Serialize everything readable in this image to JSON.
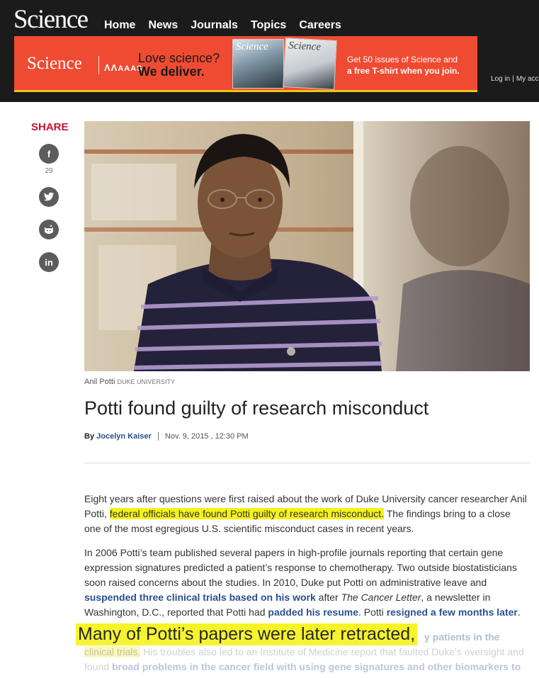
{
  "header": {
    "logo": "Science",
    "nav": [
      "Home",
      "News",
      "Journals",
      "Topics",
      "Careers"
    ],
    "login": "Log in",
    "my_account": "My acc"
  },
  "ad": {
    "brand": "Science",
    "aaas": "AAAS",
    "slogan_line1": "Love science?",
    "slogan_line2": "We deliver.",
    "magazine1_title": "Science",
    "magazine2_title": "Science",
    "offer_line1": "Get 50 issues of Science and",
    "offer_line2": "a free T-shirt when you join."
  },
  "share": {
    "label": "SHARE",
    "facebook_count": "29",
    "icons": [
      "facebook-icon",
      "twitter-icon",
      "reddit-icon",
      "linkedin-icon"
    ]
  },
  "article": {
    "caption_name": "Anil Potti",
    "caption_credit": "DUKE UNIVERSITY",
    "headline": "Potti found guilty of research misconduct",
    "by": "By",
    "author": "Jocelyn Kaiser",
    "date": "Nov. 9, 2015 , 12:30 PM",
    "p1": {
      "a": "Eight years after questions were first raised about the work of Duke University cancer researcher Anil Potti, ",
      "highlight": "federal officials have found Potti guilty of research misconduct.",
      "b": " The findings bring to a close one of the most egregious U.S. scientific misconduct cases in recent years."
    },
    "p2": {
      "a": "In 2006 Potti’s team published several papers in high-profile journals reporting that certain gene expression signatures predicted a patient’s response to chemotherapy. Two outside biostatisticians soon raised concerns about the studies. In 2010, Duke put Potti on administrative leave and ",
      "link1": "suspended three clinical trials based on his work",
      "b": " after ",
      "italic": "The Cancer Letter",
      "c": ", a newsletter in Washington, D.C., reported that Potti had ",
      "link2": "padded his resume",
      "d": ". Potti ",
      "link3": "resigned a few months later",
      "e": "."
    },
    "callout": "Many of Potti’s papers were later retracted,",
    "p3": {
      "ghost_link": "y patients in the",
      "hl": "clinical trials.",
      "a": " His troubles also led to an Institute of Medicine report that faulted Duke’s oversight and found ",
      "link": "broad problems in the cancer field with using gene signatures and other biomarkers to"
    }
  },
  "colors": {
    "header_bg": "#1b1b1b",
    "ad_bg": "#ef4b32",
    "ad_border": "#f0c419",
    "share_red": "#c8102e",
    "link_blue": "#2a4f8f",
    "highlight": "#f5f219"
  }
}
